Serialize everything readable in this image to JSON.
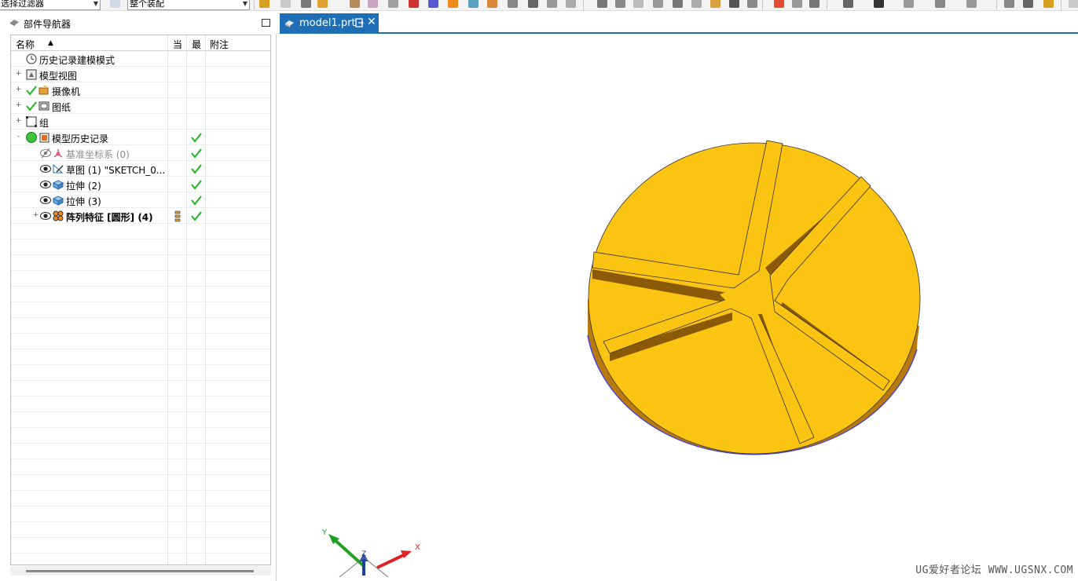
{
  "toolbar": {
    "filter_combo": "选择过滤器",
    "scope_combo": "整个装配"
  },
  "navigator": {
    "title": "部件导航器",
    "columns": {
      "name": "名称",
      "current": "当",
      "latest": "最",
      "comment": "附注"
    },
    "rows": [
      {
        "label": "历史记录建模模式",
        "icon": "clock-icon",
        "expand": "",
        "checked": false
      },
      {
        "label": "模型视图",
        "icon": "model-view-icon",
        "expand": "+",
        "checked": false
      },
      {
        "label": "摄像机",
        "icon": "camera-icon",
        "expand": "+",
        "checked": false
      },
      {
        "label": "图纸",
        "icon": "drawing-icon",
        "expand": "+",
        "checked": false
      },
      {
        "label": "组",
        "icon": "group-icon",
        "expand": "+",
        "checked": false
      },
      {
        "label": "模型历史记录",
        "icon": "model-history-icon",
        "expand": "-",
        "checked": true
      },
      {
        "label": "基准坐标系 (0)",
        "icon": "datum-csys-icon",
        "expand": "",
        "checked": true
      },
      {
        "label": "草图 (1) \"SKETCH_0...",
        "icon": "sketch-icon",
        "expand": "",
        "checked": true
      },
      {
        "label": "拉伸 (2)",
        "icon": "extrude-icon",
        "expand": "",
        "checked": true
      },
      {
        "label": "拉伸 (3)",
        "icon": "extrude-icon",
        "expand": "",
        "checked": true
      },
      {
        "label": "阵列特征 [圆形] (4)",
        "icon": "pattern-feature-icon",
        "expand": "+",
        "checked": true
      }
    ]
  },
  "tab": {
    "label": "model1.prt",
    "close": "✕"
  },
  "triad": {
    "x": "X",
    "y": "Y",
    "z": "Z"
  },
  "watermark": "UG爱好者论坛 WWW.UGSNX.COM",
  "colors": {
    "accent": "#1e6fb5",
    "model_top": "#fbc413",
    "model_side": "#b8780a",
    "check": "#22b422"
  }
}
